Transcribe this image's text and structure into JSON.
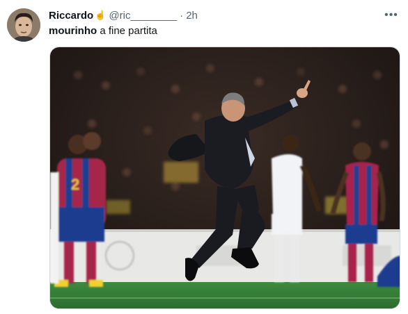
{
  "tweet": {
    "display_name": "Riccardo",
    "name_icon": "hand-icon",
    "name_icon_glyph": "☝",
    "handle": "@ric________",
    "separator": "·",
    "time": "2h",
    "more_glyph": "•••",
    "text_bold": "mourinho",
    "text_rest": " a fine partita",
    "media_icon": "photo-celebration",
    "jersey_number": "2"
  },
  "colors": {
    "text": "#0f1419",
    "secondary": "#536471",
    "pitch": "#2f7a35",
    "crowd": "#221a17"
  }
}
